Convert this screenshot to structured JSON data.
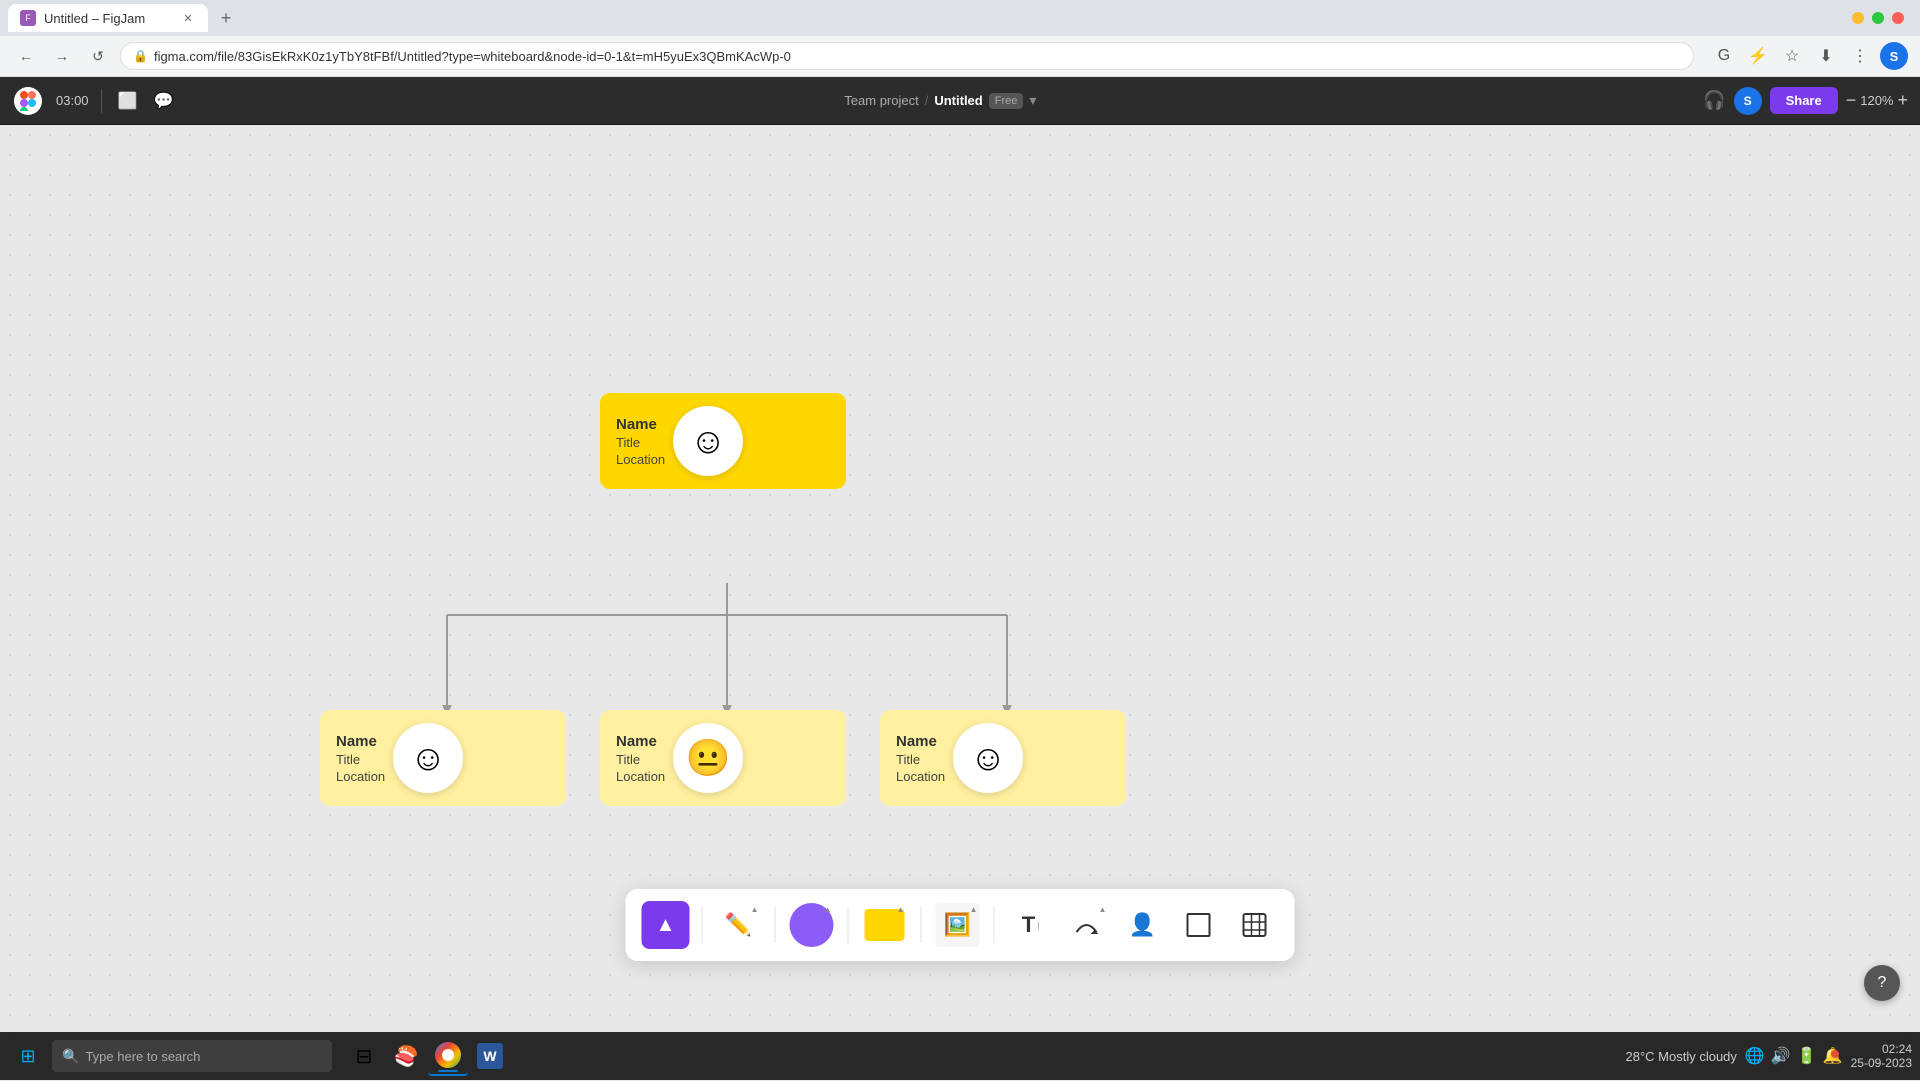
{
  "browser": {
    "tab_title": "Untitled – FigJam",
    "favicon": "F",
    "url": "figma.com/file/83GisEkRxK0z1yTbY8tFBf/Untitled?type=whiteboard&node-id=0-1&t=mH5yuEx3QBmKAcWp-0",
    "profile_letter": "S",
    "nav": {
      "back": "←",
      "forward": "→",
      "reload": "↺",
      "home": "⌂"
    }
  },
  "figma_toolbar": {
    "timer": "03:00",
    "breadcrumb_project": "Team project",
    "breadcrumb_sep": "/",
    "breadcrumb_file": "Untitled",
    "plan": "Free",
    "share_label": "Share",
    "zoom_level": "120%",
    "headphones_icon": "🎧",
    "avatar_letter": "S"
  },
  "org_chart": {
    "root": {
      "name": "Name",
      "title": "Title",
      "location": "Location",
      "smiley": "☺"
    },
    "children": [
      {
        "name": "Name",
        "title": "Title",
        "location": "Location",
        "smiley": "☺"
      },
      {
        "name": "Name",
        "title": "Title",
        "location": "Location",
        "smiley": "😐"
      },
      {
        "name": "Name",
        "title": "Title",
        "location": "Location",
        "smiley": "☺"
      }
    ]
  },
  "bottom_toolbar": {
    "tools": [
      {
        "name": "select",
        "label": "▲",
        "active": true
      },
      {
        "name": "pen",
        "label": "✏"
      },
      {
        "name": "shape-circle",
        "label": ""
      },
      {
        "name": "shape-rect",
        "label": ""
      },
      {
        "name": "sticker",
        "label": "🖼"
      },
      {
        "name": "text",
        "label": "T"
      },
      {
        "name": "connector",
        "label": "⌒"
      },
      {
        "name": "person",
        "label": "👤"
      },
      {
        "name": "frame",
        "label": "□"
      },
      {
        "name": "table",
        "label": "⊞"
      }
    ]
  },
  "taskbar": {
    "search_placeholder": "Type here to search",
    "time": "02:24",
    "date": "25-09-2023",
    "weather": "28°C  Mostly cloudy",
    "items": [
      {
        "name": "windows",
        "icon": "⊞"
      },
      {
        "name": "file-explorer",
        "icon": "📁"
      },
      {
        "name": "edge",
        "icon": "🌐"
      },
      {
        "name": "word",
        "icon": "W"
      },
      {
        "name": "chrome",
        "icon": "⬤"
      }
    ]
  },
  "help_btn": "?"
}
